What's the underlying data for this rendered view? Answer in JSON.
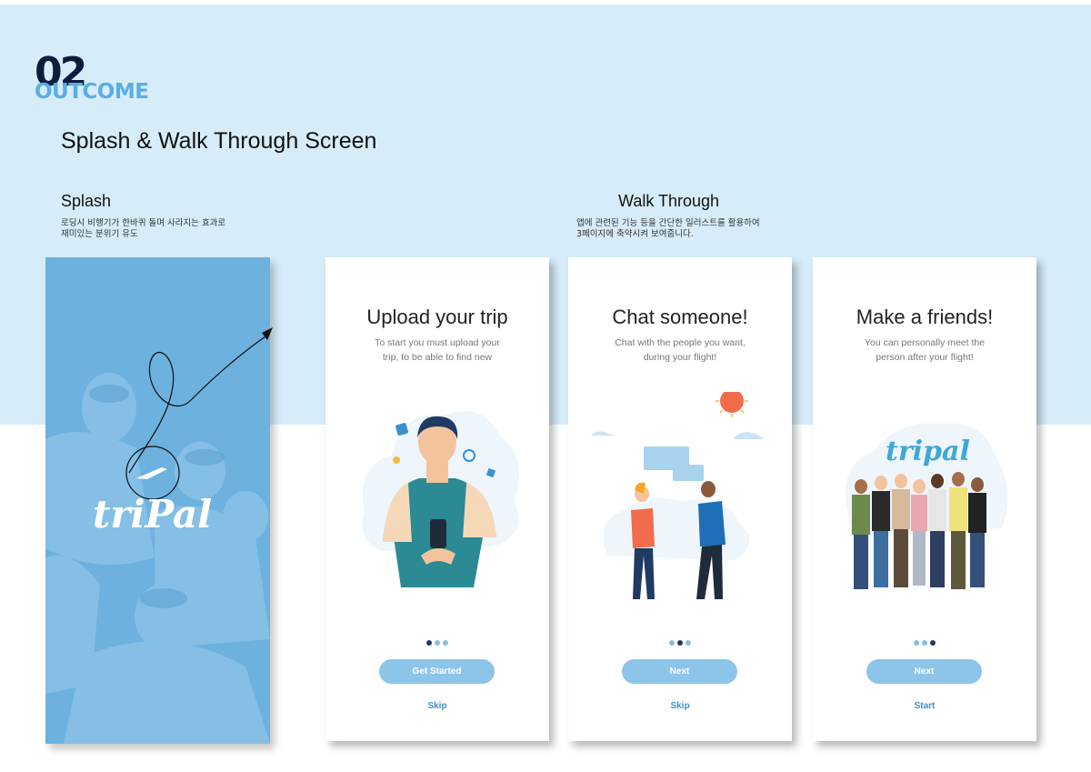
{
  "header": {
    "number": "02",
    "section": "OUTCOME",
    "title": "Splash & Walk Through Screen"
  },
  "splash": {
    "heading": "Splash",
    "description_line1": "로딩시 비행기가 한바퀴 돌며 사라지는 효과로",
    "description_line2": "재미있는 분위기 유도",
    "logo_text": "triPal"
  },
  "walkthrough": {
    "heading": "Walk Through",
    "description_line1": "앱에 관련된 기능 등을 간단한 일러스트를 활용하여",
    "description_line2": "3페이지에 축약시켜 보여줍니다.",
    "screens": [
      {
        "title": "Upload your trip",
        "desc_line1": "To start you must upload your",
        "desc_line2": "trip, to be able to find new",
        "primary_label": "Get Started",
        "secondary_label": "Skip",
        "active_dot": 0
      },
      {
        "title": "Chat someone!",
        "desc_line1": "Chat with the people you want,",
        "desc_line2": "during your flight!",
        "primary_label": "Next",
        "secondary_label": "Skip",
        "active_dot": 1
      },
      {
        "title": "Make a friends!",
        "desc_line1": "You can personally meet the",
        "desc_line2": "person after your flight!",
        "primary_label": "Next",
        "secondary_label": "Start",
        "active_dot": 2,
        "illustration_logo": "tripal"
      }
    ]
  },
  "colors": {
    "band": "#d6ecf8",
    "splash": "#6db1df",
    "button": "#8cc4ea",
    "link": "#3d8fd0",
    "navy": "#0e1b3d",
    "accent": "#5aaee3"
  }
}
